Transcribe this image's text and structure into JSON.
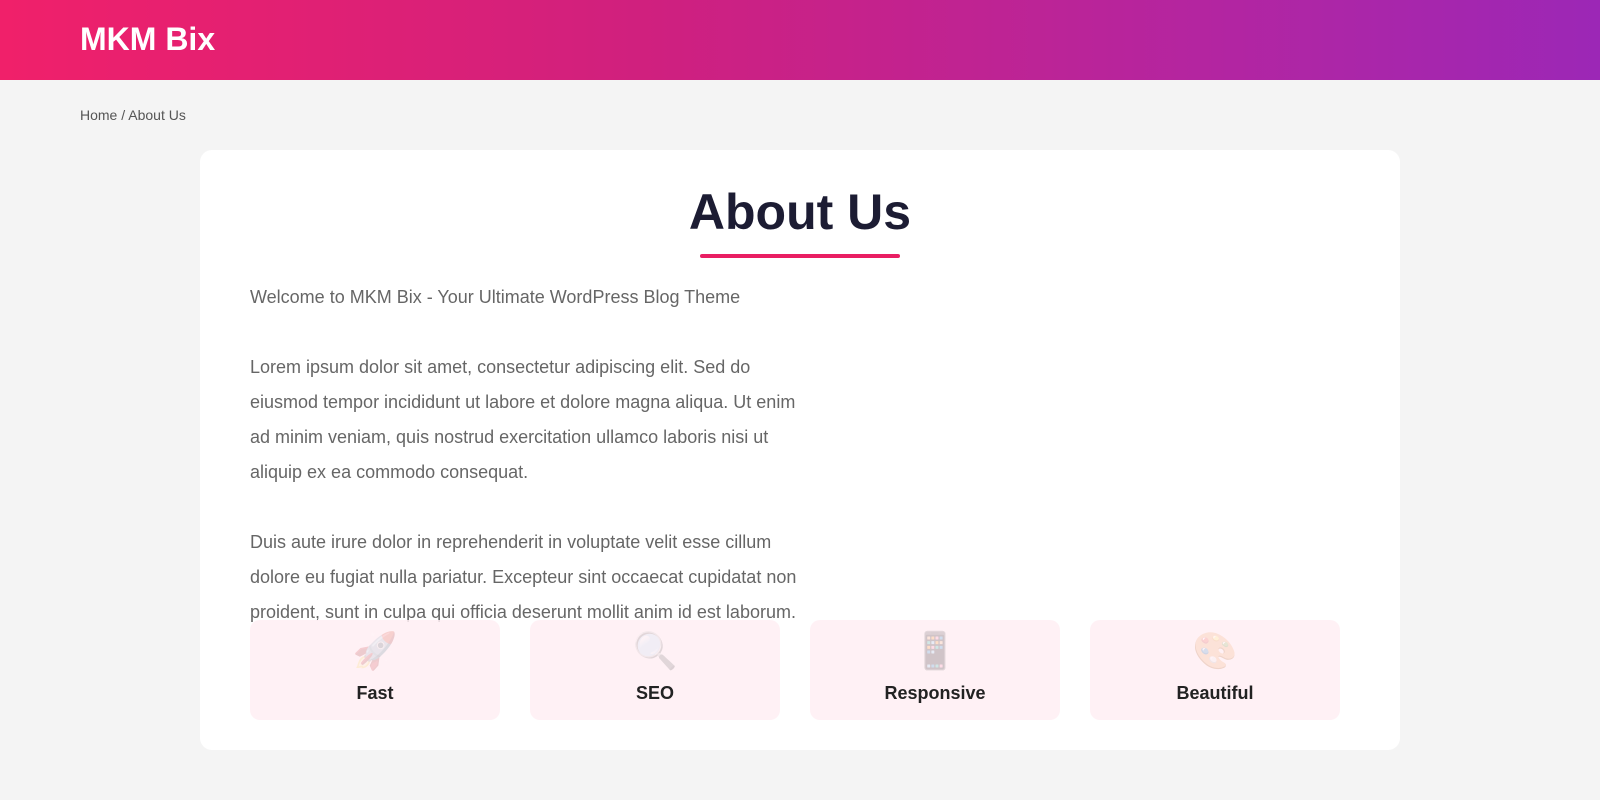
{
  "header": {
    "site_title": "MKM Bix"
  },
  "breadcrumb": {
    "home": "Home",
    "separator": " / ",
    "current": "About Us"
  },
  "page": {
    "title": "About Us",
    "paragraphs": [
      "Welcome to MKM Bix - Your Ultimate WordPress Blog Theme",
      "Lorem ipsum dolor sit amet, consectetur adipiscing elit. Sed do eiusmod tempor incididunt ut labore et dolore magna aliqua. Ut enim ad minim veniam, quis nostrud exercitation ullamco laboris nisi ut aliquip ex ea commodo consequat.",
      "Duis aute irure dolor in reprehenderit in voluptate velit esse cillum dolore eu fugiat nulla pariatur. Excepteur sint occaecat cupidatat non proident, sunt in culpa qui officia deserunt mollit anim id est laborum."
    ]
  },
  "features": [
    {
      "label": "Fast",
      "icon": "rocket-icon",
      "glyph": "🚀"
    },
    {
      "label": "SEO",
      "icon": "magnifier-icon",
      "glyph": "🔍"
    },
    {
      "label": "Responsive",
      "icon": "mobile-phone-icon",
      "glyph": "📱"
    },
    {
      "label": "Beautiful",
      "icon": "palette-icon",
      "glyph": "🎨"
    }
  ],
  "colors": {
    "accent": "#e91e63",
    "header_gradient_start": "#f0206a",
    "header_gradient_end": "#9c27b6",
    "title": "#1c1c33",
    "feature_bg": "#ffeef3"
  }
}
